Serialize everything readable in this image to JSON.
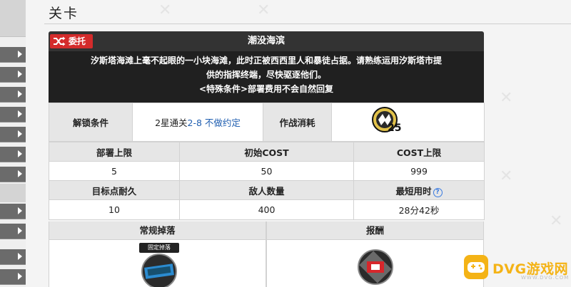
{
  "page": {
    "title": "关卡"
  },
  "stage": {
    "badge": "委托",
    "name": "潮没海滨",
    "description_line1": "汐斯塔海滩上毫不起眼的一小块海滩，此时正被西西里人和暴徒占据。请熟练运用汐斯塔市提",
    "description_line2": "供的指挥终端，尽快驱逐他们。",
    "special": "<特殊条件>部署费用不会自然回复"
  },
  "info": {
    "unlock_label": "解锁条件",
    "unlock_prefix": "2星通关",
    "unlock_stage": "2-8",
    "unlock_suffix": "不做约定",
    "cost_label": "作战消耗",
    "sanity_cost": "25"
  },
  "stats_headers": [
    "部署上限",
    "初始COST",
    "COST上限"
  ],
  "stats_values": [
    "5",
    "50",
    "999"
  ],
  "stats2_headers": [
    "目标点耐久",
    "敌人数量",
    "最短用时"
  ],
  "stats2_values": [
    "10",
    "400",
    "28分42秒"
  ],
  "help_icon": "?",
  "drops": {
    "normal_label": "常规掉落",
    "reward_label": "报酬",
    "fixed_badge": "固定掉落"
  },
  "watermark": {
    "brand": "DVG游戏网",
    "sub": "WWW.DVG.COM"
  },
  "colors": {
    "header_dark": "#333333",
    "desc_bg": "#202020",
    "badge_red": "#d42b2b",
    "link_blue": "#1f5eb0",
    "brand_yellow": "#f4b316"
  }
}
